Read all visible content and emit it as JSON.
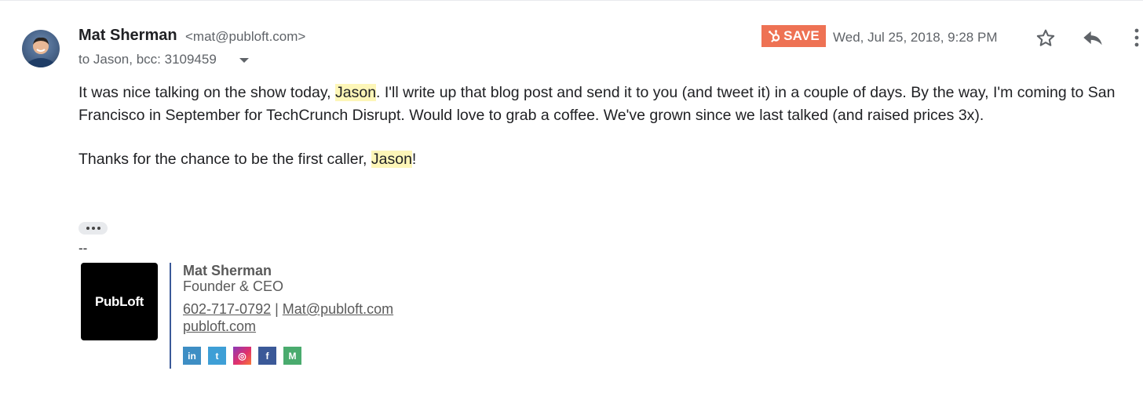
{
  "header": {
    "sender_name": "Mat Sherman",
    "sender_email": "<mat@publoft.com>",
    "recipients": "to Jason, bcc: 3109459",
    "save_label": "SAVE",
    "date": "Wed, Jul 25, 2018, 9:28 PM"
  },
  "body": {
    "p1_part1": "It was nice talking on the show today, ",
    "p1_highlight": "Jason",
    "p1_part2": ". I'll write up that blog post and send it to you  (and tweet it) in a couple of days. By the way, I'm coming to San Francisco in September for TechCrunch Disrupt. Would love to grab a coffee. We've grown since we last talked (and raised prices 3x).",
    "p2_part1": "Thanks for the chance to be the first caller, ",
    "p2_highlight": "Jason",
    "p2_part2": "!"
  },
  "signature": {
    "separator": "--",
    "logo_text": "PubLoft",
    "name": "Mat Sherman",
    "title": "Founder & CEO",
    "phone": "602-717-0792",
    "pipe": " | ",
    "email": "Mat@publoft.com",
    "website": "publoft.com",
    "social": [
      {
        "icon": "linkedin-icon",
        "glyph": "in"
      },
      {
        "icon": "twitter-icon",
        "glyph": "t"
      },
      {
        "icon": "instagram-icon",
        "glyph": "◎"
      },
      {
        "icon": "facebook-icon",
        "glyph": "f"
      },
      {
        "icon": "medium-icon",
        "glyph": "M"
      }
    ]
  },
  "colors": {
    "save_button": "#ee7254",
    "highlight": "#fdf6b8",
    "signature_divider": "#3b5998",
    "linkedin": "#3e8ec4",
    "twitter": "#3e9fd6",
    "facebook": "#3b5998",
    "medium": "#4aab6e"
  }
}
